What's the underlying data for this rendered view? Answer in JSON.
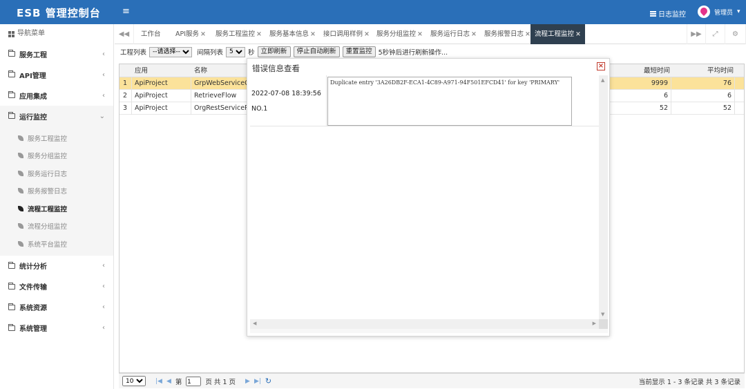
{
  "header": {
    "brand": "ESB 管理控制台",
    "menu_toggle": "≡",
    "log_link": "日志监控",
    "user_name": "管理员",
    "user_caret": "▾"
  },
  "sidebar": {
    "title": "导航菜单",
    "items": [
      {
        "label": "服务工程",
        "chev": "‹"
      },
      {
        "label": "API管理",
        "chev": "‹"
      },
      {
        "label": "应用集成",
        "chev": "‹"
      },
      {
        "label": "运行监控",
        "chev": "⌄"
      },
      {
        "label": "统计分析",
        "chev": "‹"
      },
      {
        "label": "文件传输",
        "chev": "‹"
      },
      {
        "label": "系统资源",
        "chev": "‹"
      },
      {
        "label": "系统管理",
        "chev": "‹"
      }
    ],
    "sub_items": [
      "服务工程监控",
      "服务分组监控",
      "服务运行日志",
      "服务报警日志",
      "流程工程监控",
      "流程分组监控",
      "系统平台监控"
    ]
  },
  "tabs": {
    "prev": "◀◀",
    "next": "▶▶",
    "fullscreen": "⤢",
    "settings": "⚙",
    "items": [
      {
        "label": "工作台",
        "closable": ""
      },
      {
        "label": "API服务",
        "closable": "×"
      },
      {
        "label": "服务工程监控",
        "closable": "×"
      },
      {
        "label": "服务基本信息",
        "closable": "×"
      },
      {
        "label": "接口调用样例",
        "closable": "×"
      },
      {
        "label": "服务分组监控",
        "closable": "×"
      },
      {
        "label": "服务运行日志",
        "closable": "×"
      },
      {
        "label": "服务报警日志",
        "closable": "×"
      },
      {
        "label": "流程工程监控",
        "closable": "×"
      }
    ]
  },
  "toolbar": {
    "project_list_label": "工程列表",
    "project_select": "--请选择--",
    "interval_label": "间隔列表",
    "interval_value": "5",
    "seconds_label": "秒",
    "refresh_now": "立即刷新",
    "stop_auto": "停止自动刷新",
    "reset": "重置监控",
    "countdown": "5秒钟后进行刷新操作..."
  },
  "grid": {
    "headers": {
      "app": "应用",
      "name": "名称",
      "min": "最短时间",
      "avg": "平均时间"
    },
    "rows": [
      {
        "idx": "1",
        "app": "ApiProject",
        "name": "GrpWebServiceCr",
        "min": "9999",
        "avg": "76"
      },
      {
        "idx": "2",
        "app": "ApiProject",
        "name": "RetrieveFlow",
        "min": "6",
        "avg": "6"
      },
      {
        "idx": "3",
        "app": "ApiProject",
        "name": "OrgRestServiceRe",
        "min": "52",
        "avg": "52"
      }
    ]
  },
  "pager": {
    "page_size": "10",
    "page_prefix": "第",
    "page_value": "1",
    "page_suffix": "页 共 1 页",
    "info": "当前显示 1 - 3 条记录 共 3 条记录",
    "first": "|◀",
    "prev": "◀",
    "next": "▶",
    "last": "▶|",
    "refresh": "↻"
  },
  "dialog": {
    "title": "错误信息查看",
    "close": "×",
    "time": "2022-07-08 18:39:56",
    "number": "NO.1",
    "message": "Duplicate entry '3A26DB2F-ECA1-4C89-A971-94F501EFCD41' for key 'PRIMARY'"
  },
  "colors": {
    "header_bg": "#2a6fb8",
    "active_tab_bg": "#2f4050",
    "selected_row": "#fbe29a"
  }
}
